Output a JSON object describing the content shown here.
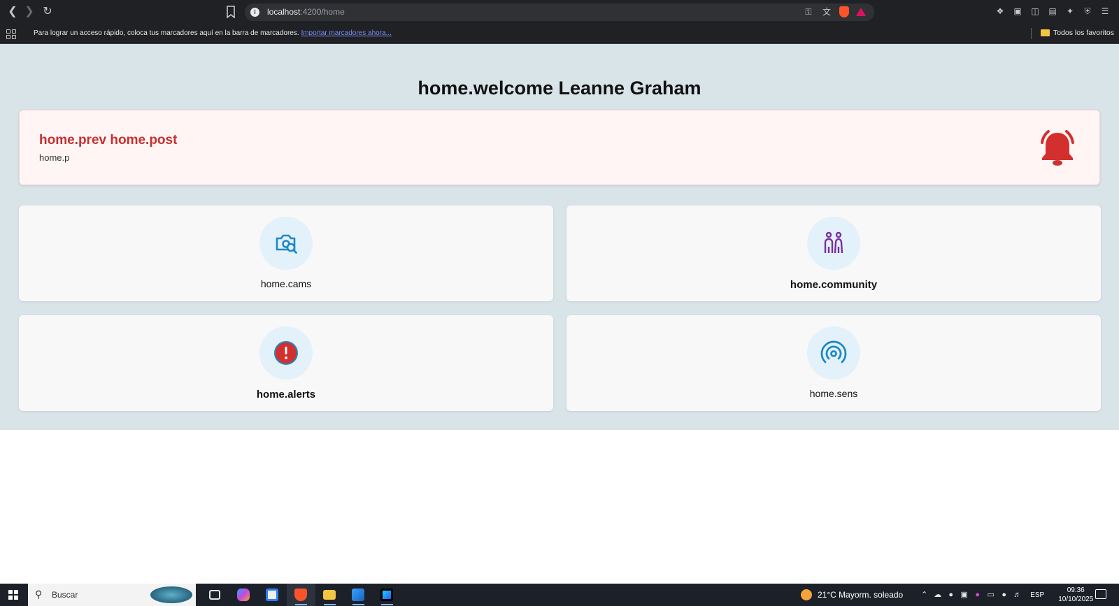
{
  "browser": {
    "url_host": "localhost",
    "url_path": ":4200/home",
    "bookmarks_bar": {
      "message": "Para lograr un acceso rápido, coloca tus marcadores aquí en la barra de marcadores.",
      "import_link": "Importar marcadores ahora...",
      "all_favorites": "Todos los favoritos"
    }
  },
  "page": {
    "title": "home.welcome Leanne Graham",
    "alert_card": {
      "title": "home.prev home.post",
      "subtitle": "home.p",
      "icon": "bell-icon",
      "color": "#d32f2f"
    },
    "cards": [
      {
        "label": "home.cams",
        "icon": "camera-search-icon",
        "icon_color": "#1e88c8"
      },
      {
        "label": "home.community",
        "icon": "people-icon",
        "icon_color": "#7b2f9e"
      },
      {
        "label": "home.alerts",
        "icon": "alert-circle-icon",
        "icon_color": "#d32f2f"
      },
      {
        "label": "home.sens",
        "icon": "sensor-signal-icon",
        "icon_color": "#1e88c8"
      }
    ]
  },
  "taskbar": {
    "search_placeholder": "Buscar",
    "weather": "21°C  Mayorm. soleado",
    "language": "ESP",
    "time": "09:36",
    "date": "10/10/2025"
  }
}
